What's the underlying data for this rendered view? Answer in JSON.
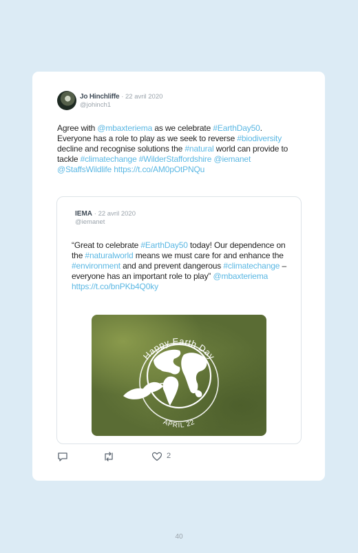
{
  "tweet": {
    "author_name": "Jo Hinchliffe",
    "date": "· 22 avril 2020",
    "handle": "@johinch1",
    "text_segments": [
      {
        "t": "Agree with ",
        "link": false
      },
      {
        "t": "@mbaxteriema",
        "link": true
      },
      {
        "t": " as we celebrate ",
        "link": false
      },
      {
        "t": "#EarthDay50",
        "link": true
      },
      {
        "t": ". Everyone has a role to play as we seek to reverse ",
        "link": false
      },
      {
        "t": "#biodiversity",
        "link": true
      },
      {
        "t": " decline and recognise solutions the ",
        "link": false
      },
      {
        "t": "#natural",
        "link": true
      },
      {
        "t": " world can provide to tackle ",
        "link": false
      },
      {
        "t": "#climatechange",
        "link": true
      },
      {
        "t": " ",
        "link": false
      },
      {
        "t": "#WilderStaffordshire",
        "link": true
      },
      {
        "t": " ",
        "link": false
      },
      {
        "t": "@iemanet",
        "link": true
      },
      {
        "t": " ",
        "link": false
      },
      {
        "t": "@StaffsWildlife",
        "link": true
      },
      {
        "t": " ",
        "link": false
      },
      {
        "t": "https://t.co/AM0pOtPNQu",
        "link": true
      }
    ],
    "like_count": "2"
  },
  "quoted_tweet": {
    "author_name": "IEMA",
    "date": "· 22 avril 2020",
    "handle": "@iemanet",
    "text_segments": [
      {
        "t": "“Great to celebrate ",
        "link": false
      },
      {
        "t": "#EarthDay50",
        "link": true
      },
      {
        "t": " today! Our dependence on the ",
        "link": false
      },
      {
        "t": "#naturalworld",
        "link": true
      },
      {
        "t": " means we must care for and enhance the ",
        "link": false
      },
      {
        "t": "#environment",
        "link": true
      },
      {
        "t": " and and prevent dangerous ",
        "link": false
      },
      {
        "t": "#climatechange",
        "link": true
      },
      {
        "t": " – everyone has an important role to play” ",
        "link": false
      },
      {
        "t": "@mbaxteriema",
        "link": true
      },
      {
        "t": " ",
        "link": false
      },
      {
        "t": "https://t.co/bnPKb4Q0ky",
        "link": true
      }
    ],
    "media": {
      "top_text": "Happy Earth Day",
      "bottom_text": "APRIL 22",
      "icon": "globe-with-leaves-icon"
    }
  },
  "actions": {
    "reply_icon": "reply-icon",
    "retweet_icon": "retweet-icon",
    "like_icon": "heart-icon"
  },
  "page_number": "40",
  "colors": {
    "background": "#dcebf5",
    "link": "#5ab7e3",
    "muted": "#9aa3ab"
  }
}
